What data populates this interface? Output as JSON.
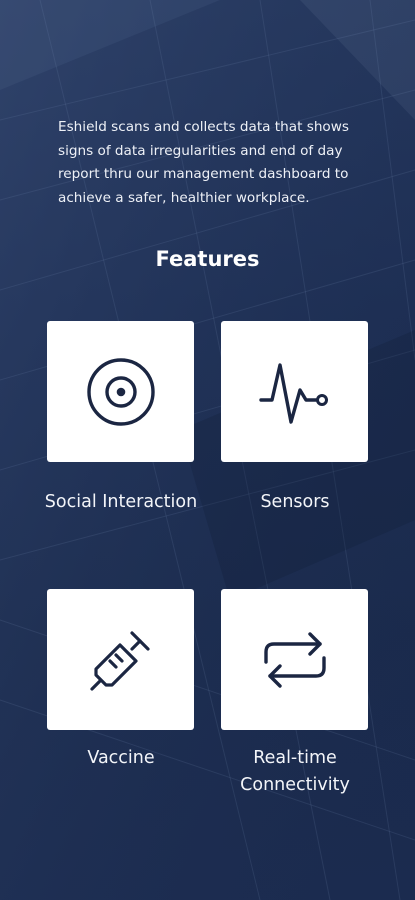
{
  "intro": {
    "text": "Eshield scans and collects data that shows signs of data irregularities and end of day report thru our management dashboard to achieve a safer, healthier workplace."
  },
  "features": {
    "title": "Features",
    "items": [
      {
        "label": "Social Interaction",
        "icon": "target-icon"
      },
      {
        "label": "Sensors",
        "icon": "pulse-icon"
      },
      {
        "label": "Vaccine",
        "icon": "syringe-icon"
      },
      {
        "label": "Real-time Connectivity",
        "icon": "sync-arrows-icon"
      }
    ]
  },
  "colors": {
    "background": "#1c2d52",
    "card": "#ffffff",
    "icon": "#1b2642",
    "text": "#ffffff"
  }
}
